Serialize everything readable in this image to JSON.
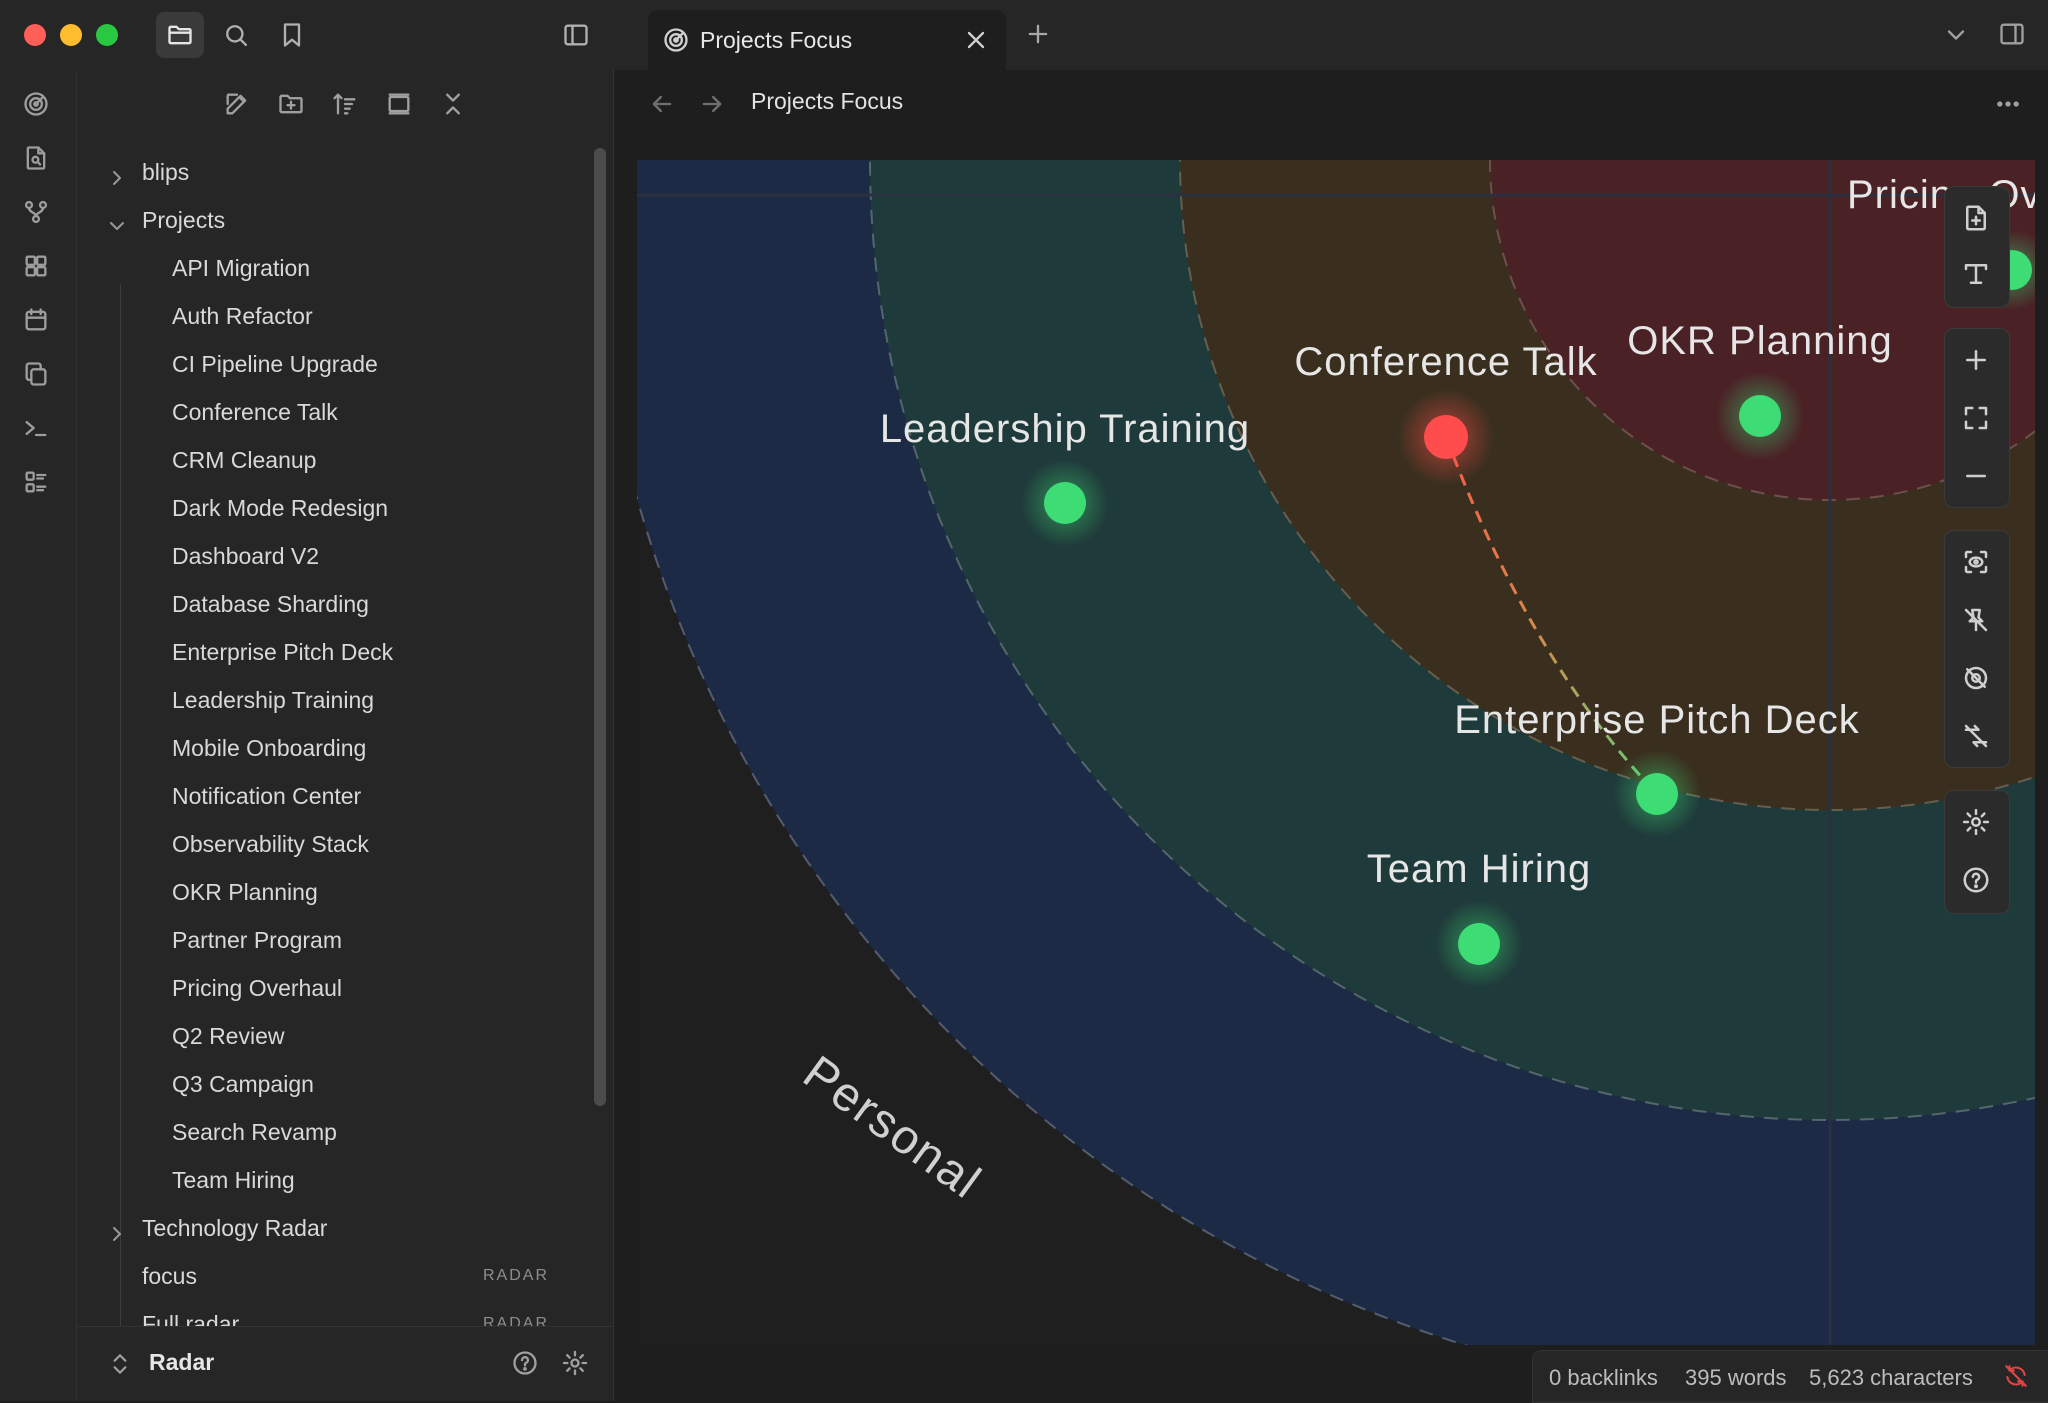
{
  "window": {
    "tab_title": "Projects Focus"
  },
  "header": {
    "title": "Projects Focus"
  },
  "sidebar": {
    "tree": [
      {
        "label": "blips",
        "expanded": false
      },
      {
        "label": "Projects",
        "expanded": true
      },
      {
        "label": "API Migration"
      },
      {
        "label": "Auth Refactor"
      },
      {
        "label": "CI Pipeline Upgrade"
      },
      {
        "label": "Conference Talk"
      },
      {
        "label": "CRM Cleanup"
      },
      {
        "label": "Dark Mode Redesign"
      },
      {
        "label": "Dashboard V2"
      },
      {
        "label": "Database Sharding"
      },
      {
        "label": "Enterprise Pitch Deck"
      },
      {
        "label": "Leadership Training"
      },
      {
        "label": "Mobile Onboarding"
      },
      {
        "label": "Notification Center"
      },
      {
        "label": "Observability Stack"
      },
      {
        "label": "OKR Planning"
      },
      {
        "label": "Partner Program"
      },
      {
        "label": "Pricing Overhaul"
      },
      {
        "label": "Q2 Review"
      },
      {
        "label": "Q3 Campaign"
      },
      {
        "label": "Search Revamp"
      },
      {
        "label": "Team Hiring"
      },
      {
        "label": "Technology Radar",
        "expanded": false
      },
      {
        "label": "focus",
        "tag": "RADAR"
      },
      {
        "label": "Full radar",
        "tag": "RADAR"
      }
    ],
    "vault_name": "Radar"
  },
  "radar": {
    "ring_label": "Personal",
    "blips": [
      {
        "label": "Leadership Training",
        "status": "green"
      },
      {
        "label": "Conference Talk",
        "status": "red"
      },
      {
        "label": "OKR Planning",
        "status": "green"
      },
      {
        "label": "Enterprise Pitch Deck",
        "status": "green"
      },
      {
        "label": "Team Hiring",
        "status": "green"
      },
      {
        "label": "Pricing Overhaul",
        "status": "green",
        "partially_visible_text": "Pricing Ov"
      }
    ],
    "link": {
      "from": "Conference Talk",
      "to": "Enterprise Pitch Deck"
    },
    "colors": {
      "green": "#3ddc74",
      "red": "#ff4d4d",
      "ring_outer": "#1c2a45",
      "ring_mid": "#1f3a3a",
      "ring_inner": "#3a2f1e",
      "ring_core": "#4a2226"
    }
  },
  "statusbar": {
    "backlinks": "0 backlinks",
    "words": "395 words",
    "characters": "5,623 characters"
  },
  "icons": {
    "titlebar": [
      "folder-icon",
      "search-icon",
      "bookmark-icon",
      "sidebar-toggle-icon",
      "radar-icon",
      "close-icon",
      "plus-icon",
      "chevron-down-icon",
      "right-sidebar-icon"
    ],
    "ribbon": [
      "radar-icon",
      "file-search-icon",
      "git-fork-icon",
      "layout-grid-icon",
      "calendar-icon",
      "copy-icon",
      "terminal-icon",
      "list-icon"
    ],
    "canvas_controls": [
      "new-file-icon",
      "text-format-icon",
      "zoom-in-icon",
      "fit-screen-icon",
      "zoom-out-icon",
      "focus-icon",
      "unpin-icon",
      "hide-icon",
      "unlink-icon",
      "settings-icon",
      "help-icon"
    ]
  }
}
